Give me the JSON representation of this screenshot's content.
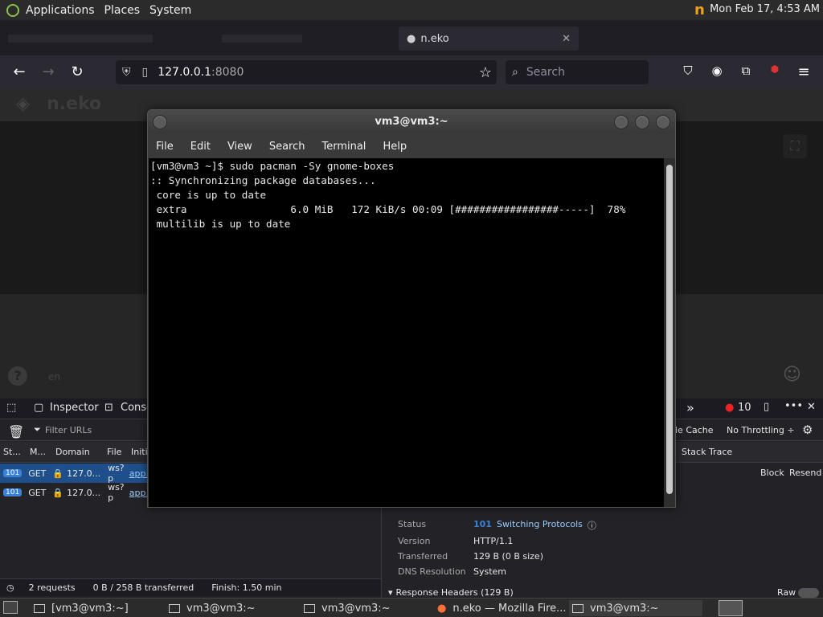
{
  "top_panel": {
    "applications": "Applications",
    "places": "Places",
    "system": "System",
    "clock": "Mon Feb 17,  4:53 AM"
  },
  "browser": {
    "tab_active_title": "n.eko",
    "url_host": "127.0.0.1",
    "url_port": ":8080",
    "search_placeholder": "Search"
  },
  "neko": {
    "logo": "n.eko",
    "lang": "en"
  },
  "devtools": {
    "inspector": "Inspector",
    "console": "Consc",
    "errors": "10",
    "filter_placeholder": "Filter URLs",
    "cache_label": "le Cache",
    "throttling": "No Throttling ÷",
    "columns": [
      "St...",
      "M...",
      "Domain",
      "File",
      "Initi"
    ],
    "stack_trace": "Stack Trace",
    "block": "Block",
    "resend": "Resend",
    "requests": [
      {
        "status": "101",
        "method": "GET",
        "domain": "127.0...",
        "file": "ws?p",
        "init": "app."
      },
      {
        "status": "101",
        "method": "GET",
        "domain": "127.0...",
        "file": "ws?p",
        "init": "app."
      }
    ],
    "detail": {
      "status_label": "Status",
      "status_code": "101",
      "status_text": "Switching Protocols",
      "version_label": "Version",
      "version": "HTTP/1.1",
      "transferred_label": "Transferred",
      "transferred": "129 B (0 B size)",
      "dns_label": "DNS Resolution",
      "dns": "System",
      "response_headers": "Response Headers (129 B)",
      "raw": "Raw"
    },
    "status_bar": {
      "requests": "2 requests",
      "transferred": "0 B / 258 B transferred",
      "finish": "Finish: 1.50 min"
    }
  },
  "terminal": {
    "title": "vm3@vm3:~",
    "menu": [
      "File",
      "Edit",
      "View",
      "Search",
      "Terminal",
      "Help"
    ],
    "lines": [
      "[vm3@vm3 ~]$ sudo pacman -Sy gnome-boxes",
      ":: Synchronizing package databases...",
      " core is up to date",
      " extra                 6.0 MiB   172 KiB/s 00:09 [#################-----]  78%",
      " multilib is up to date"
    ]
  },
  "taskbar": [
    {
      "label": "[vm3@vm3:~]"
    },
    {
      "label": "vm3@vm3:~"
    },
    {
      "label": "vm3@vm3:~"
    },
    {
      "label": "n.eko — Mozilla Fire..."
    },
    {
      "label": "vm3@vm3:~"
    }
  ],
  "colors": {
    "accent": "#3b82d6",
    "terminal_bg": "#000000",
    "panel": "#2b2b2b"
  }
}
